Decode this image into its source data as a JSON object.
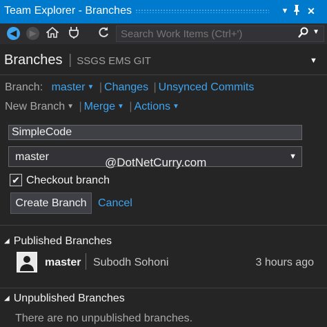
{
  "window": {
    "title": "Team Explorer - Branches",
    "controls": {
      "dropdown": "▼",
      "pin": "ᛘ",
      "close": "✕"
    }
  },
  "toolbar": {
    "back_icon": "arrow-left-icon",
    "forward_icon": "arrow-right-icon",
    "home_icon": "home-icon",
    "connect_icon": "plug-icon",
    "refresh_icon": "refresh-icon",
    "search_placeholder": "Search Work Items (Ctrl+')"
  },
  "page": {
    "title": "Branches",
    "repo": "SSGS EMS GIT"
  },
  "branch_bar": {
    "label": "Branch:",
    "current": "master",
    "links": [
      "Changes",
      "Unsynced Commits"
    ]
  },
  "action_bar": {
    "new_branch": "New Branch",
    "merge": "Merge",
    "actions": "Actions"
  },
  "new_branch_form": {
    "name_value": "SimpleCode",
    "source_branch": "master",
    "checkout_label": "Checkout branch",
    "checkout_checked": true,
    "create_label": "Create Branch",
    "cancel_label": "Cancel"
  },
  "watermark": "@DotNetCurry.com",
  "published": {
    "heading": "Published Branches",
    "branches": [
      {
        "name": "master",
        "author": "Subodh Sohoni",
        "time": "3 hours ago"
      }
    ]
  },
  "unpublished": {
    "heading": "Unpublished Branches",
    "empty_text": "There are no unpublished branches."
  },
  "colors": {
    "accent": "#007acc",
    "link": "#3ea4f0",
    "background": "#252526"
  }
}
